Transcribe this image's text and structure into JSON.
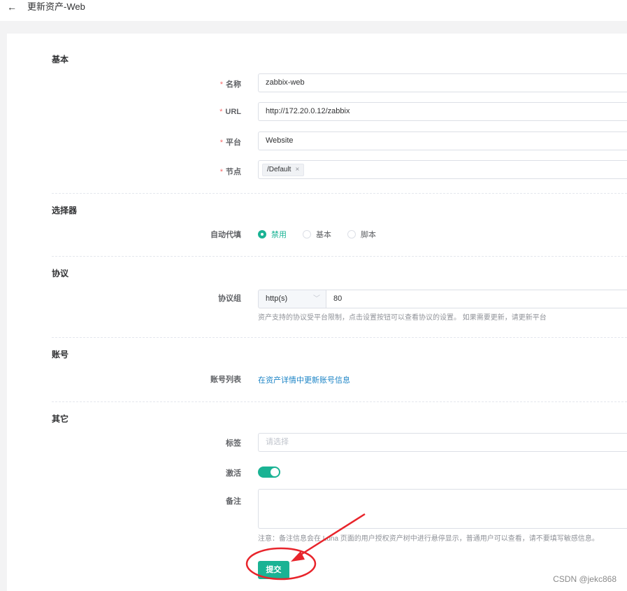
{
  "header": {
    "back_icon": "arrow-left-icon",
    "title": "更新资产-Web"
  },
  "sections": {
    "basic": "基本",
    "selector": "选择器",
    "protocol": "协议",
    "account": "账号",
    "other": "其它"
  },
  "basic": {
    "name_label": "名称",
    "name_value": "zabbix-web",
    "url_label": "URL",
    "url_value": "http://172.20.0.12/zabbix",
    "platform_label": "平台",
    "platform_value": "Website",
    "node_label": "节点",
    "node_tag": "/Default",
    "node_tag_close": "×",
    "required_mark": "*"
  },
  "selector": {
    "autofill_label": "自动代填",
    "options": [
      "禁用",
      "基本",
      "脚本"
    ],
    "selected": "禁用"
  },
  "protocol": {
    "group_label": "协议组",
    "protocol_value": "http(s)",
    "port_value": "80",
    "help": "资产支持的协议受平台限制，点击设置按钮可以查看协议的设置。 如果需要更新，请更新平台"
  },
  "account": {
    "list_label": "账号列表",
    "link_text": "在资产详情中更新账号信息"
  },
  "other": {
    "labels_label": "标签",
    "labels_placeholder": "请选择",
    "active_label": "激活",
    "active_on": true,
    "comment_label": "备注",
    "comment_value": "",
    "note": "注意：备注信息会在 Luna 页面的用户授权资产树中进行悬停显示，普通用户可以查看，请不要填写敏感信息。"
  },
  "actions": {
    "submit_label": "提交"
  },
  "watermark": "CSDN @jekc868",
  "colors": {
    "accent": "#1ab394",
    "link": "#1c84c6",
    "required": "#f56c6c",
    "annotation": "#e8242b"
  }
}
